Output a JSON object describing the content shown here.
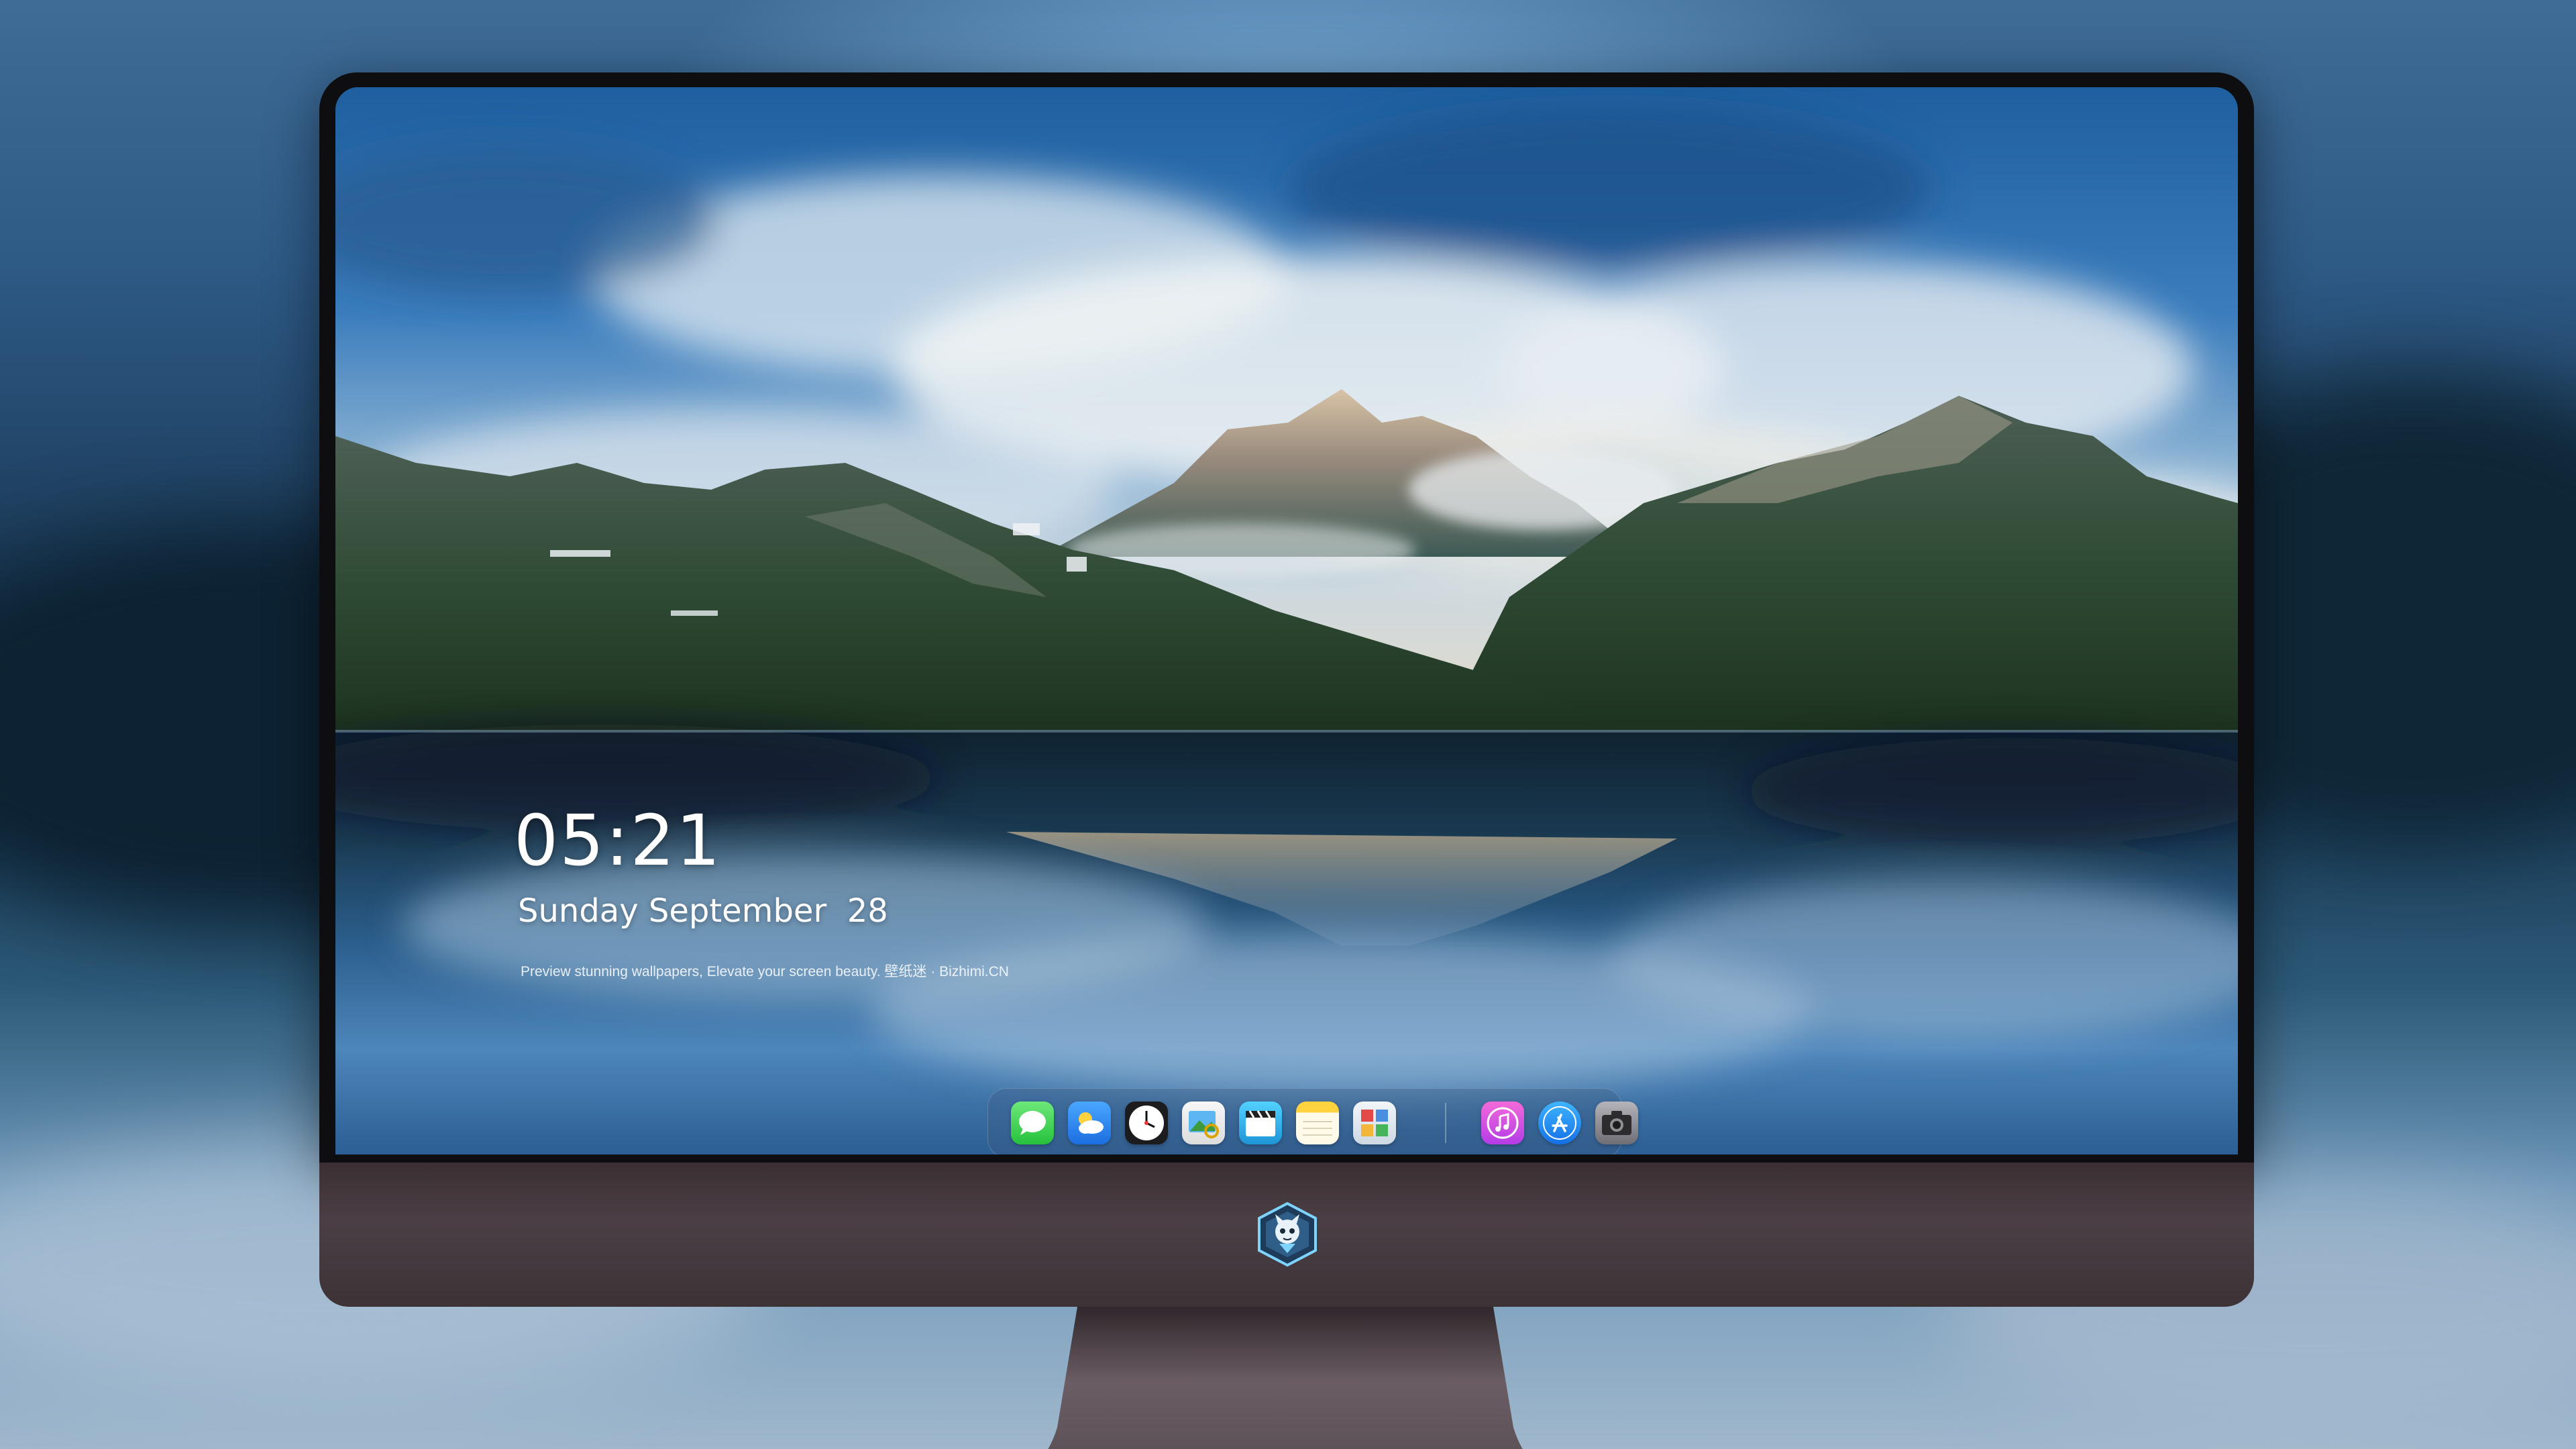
{
  "lock_screen": {
    "time": "05:21",
    "date": "Sunday September  28",
    "tagline": "Preview stunning wallpapers, Elevate your screen beauty. 壁纸迷 · Bizhimi.CN"
  },
  "dock": {
    "apps": [
      {
        "name": "messages-icon",
        "color": "#34c759"
      },
      {
        "name": "weather-icon",
        "color": "#2f8ff5"
      },
      {
        "name": "clock-icon",
        "color": "#ffffff"
      },
      {
        "name": "preview-icon",
        "color": "#f2f2f2"
      },
      {
        "name": "clips-icon",
        "color": "#3fb7e8"
      },
      {
        "name": "notes-icon",
        "color": "#ffd23f"
      },
      {
        "name": "photo-booth-icon",
        "color": "#e9eef3"
      }
    ],
    "apps_right": [
      {
        "name": "itunes-icon",
        "color": "#e54cd1"
      },
      {
        "name": "app-store-icon",
        "color": "#1a8cff"
      },
      {
        "name": "camera-icon",
        "color": "#8e8e93"
      }
    ]
  },
  "colors": {
    "bezel": "#0e0e10",
    "chin": "#43383d",
    "stand": "#5a4f54",
    "sky": "#2f73b5",
    "water": "#1f4e79"
  }
}
